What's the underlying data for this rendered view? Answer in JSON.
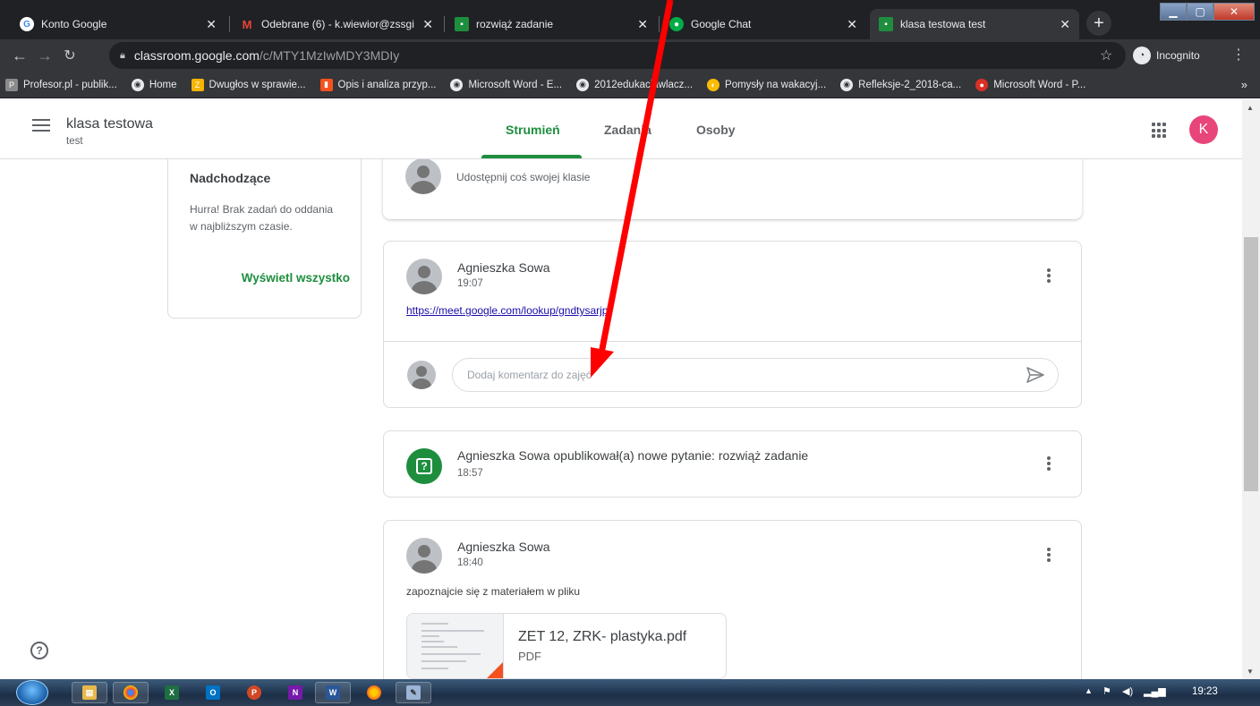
{
  "browser": {
    "tabs": [
      {
        "title": "Konto Google",
        "favicon": "google-icon",
        "color": "#ffffff"
      },
      {
        "title": "Odebrane (6) - k.wiewior@zssgi",
        "favicon": "gmail-icon",
        "color": "#ea4335"
      },
      {
        "title": "rozwiąż zadanie",
        "favicon": "classroom-icon",
        "color": "#1e8e3e"
      },
      {
        "title": "Google Chat",
        "favicon": "chat-icon",
        "color": "#00ac47"
      },
      {
        "title": "klasa testowa test",
        "favicon": "classroom-icon",
        "color": "#1e8e3e"
      }
    ],
    "url_host": "classroom.google.com",
    "url_path": "/c/MTY1MzIwMDY3MDIy",
    "incognito_label": "Incognito",
    "bookmarks": [
      "Profesor.pl - publik...",
      "Home",
      "Dwugłos w sprawie...",
      "Opis i analiza przyp...",
      "Microsoft Word - E...",
      "2012edukacjawlacz...",
      "Pomysły na wakacyj...",
      "Refleksje-2_2018-ca...",
      "Microsoft Word - P..."
    ],
    "bookmarks_more": "»"
  },
  "header": {
    "class_name": "klasa testowa",
    "class_section": "test",
    "tabs": [
      "Strumień",
      "Zadania",
      "Osoby"
    ],
    "avatar_letter": "K",
    "accent": "#1e8e3e"
  },
  "upcoming": {
    "title": "Nadchodzące",
    "text": "Hurra! Brak zadań do oddania w najbliższym czasie.",
    "link": "Wyświetl wszystko"
  },
  "share": {
    "placeholder": "Udostępnij coś swojej klasie"
  },
  "posts": [
    {
      "author": "Agnieszka Sowa",
      "time": "19:07",
      "link": "https://meet.google.com/lookup/gndtysarjp",
      "comment_placeholder": "Dodaj komentarz do zajęć"
    },
    {
      "text": "Agnieszka Sowa opublikował(a) nowe pytanie: rozwiąż zadanie",
      "time": "18:57"
    },
    {
      "author": "Agnieszka Sowa",
      "time": "18:40",
      "body": "zapoznajcie się z materiałem w pliku",
      "attachment_name": "ZET 12, ZRK- plastyka.pdf",
      "attachment_type": "PDF"
    }
  ],
  "help_glyph": "?",
  "taskbar": {
    "clock": "19:23"
  }
}
